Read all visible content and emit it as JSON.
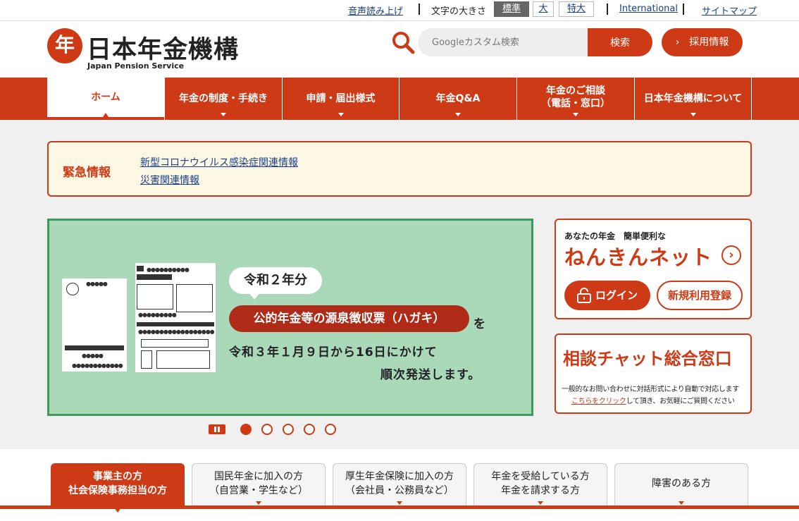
{
  "utility": {
    "read_aloud": "音声読み上げ",
    "font_size_label": "文字の大きさ",
    "font_sizes": [
      "標準",
      "大",
      "特大"
    ],
    "international": "International",
    "sitemap": "サイトマップ"
  },
  "header": {
    "logo_mark": "年",
    "logo_jp": "日本年金機構",
    "logo_en": "Japan Pension Service",
    "search_placeholder": "Googleカスタム検索",
    "search_button": "検索",
    "recruit": "採用情報"
  },
  "nav": {
    "items": [
      "ホーム",
      "年金の制度・手続き",
      "申請・届出様式",
      "年金Q&A",
      "年金のご相談\n（電話・窓口）",
      "日本年金機構について"
    ]
  },
  "emergency": {
    "title": "緊急情報",
    "links": [
      "新型コロナウイルス感染症関連情報",
      "災害関連情報"
    ]
  },
  "banner": {
    "tag1": "令和２年分",
    "tag2": "公的年金等の源泉徴収票（ハガキ）",
    "tag2_suffix": "を",
    "line1": "令和３年１月９日から16日にかけて",
    "line2": "順次発送します。",
    "slide_count": 5,
    "active_slide": 1
  },
  "nenkin_net": {
    "subtitle": "あなたの年金　簡単便利な",
    "title": "ねんきんネット",
    "login": "ログイン",
    "register": "新規利用登録"
  },
  "chat": {
    "title": "相談チャット総合窓口",
    "desc1": "一般的なお問い合わせに対話形式により自動で対応します",
    "desc2_link": "こちらをクリック",
    "desc2_rest": "して頂き、お気軽にご質問ください"
  },
  "audience_tabs": [
    "事業主の方\n社会保険事務担当の方",
    "国民年金に加入の方\n（自営業・学生など）",
    "厚生年金保険に加入の方\n（会社員・公務員など）",
    "年金を受給している方\n年金を請求する方",
    "障害のある方"
  ],
  "colors": {
    "brand": "#cf3a16",
    "banner_bg": "#a9d9b8",
    "banner_border": "#3d9a5b",
    "notice_bg": "#fdf8e4"
  }
}
